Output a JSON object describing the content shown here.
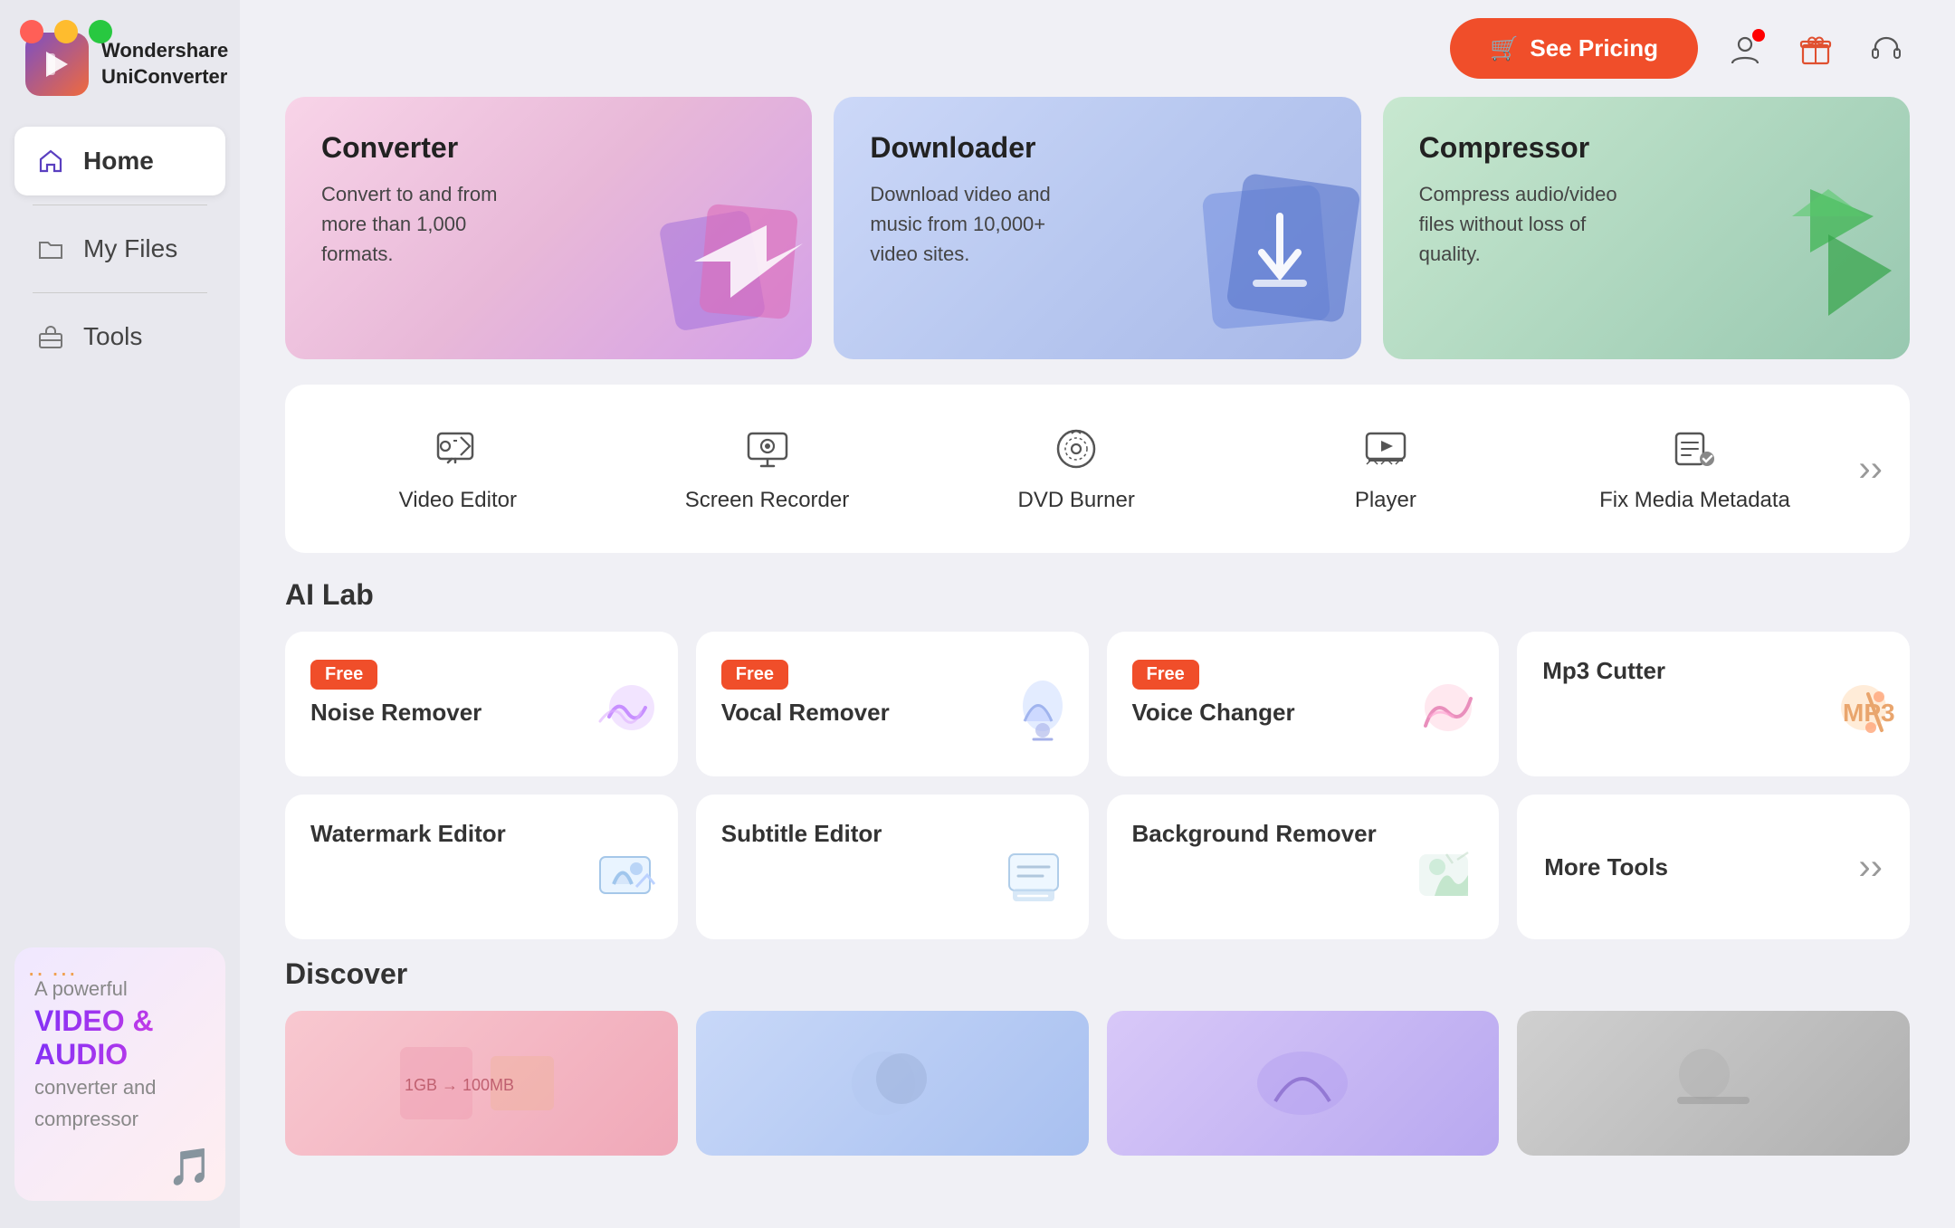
{
  "app": {
    "name_line1": "Wondershare",
    "name_line2": "UniConverter"
  },
  "topbar": {
    "see_pricing_label": "See Pricing",
    "cart_icon": "🛒"
  },
  "sidebar": {
    "nav_items": [
      {
        "id": "home",
        "label": "Home",
        "active": true,
        "icon": "home"
      },
      {
        "id": "myfiles",
        "label": "My Files",
        "active": false,
        "icon": "folder"
      },
      {
        "id": "tools",
        "label": "Tools",
        "active": false,
        "icon": "toolbox"
      }
    ]
  },
  "banner": {
    "line1": "A powerful",
    "highlight_line1": "VIDEO &",
    "highlight_line2": "AUDIO",
    "line2": "converter and",
    "line3": "compressor"
  },
  "feature_cards": [
    {
      "id": "converter",
      "title": "Converter",
      "desc": "Convert to and from more than 1,000 formats.",
      "theme": "converter"
    },
    {
      "id": "downloader",
      "title": "Downloader",
      "desc": "Download video and music from 10,000+ video sites.",
      "theme": "downloader"
    },
    {
      "id": "compressor",
      "title": "Compressor",
      "desc": "Compress audio/video files without loss of quality.",
      "theme": "compressor"
    }
  ],
  "tools": [
    {
      "id": "video-editor",
      "label": "Video Editor",
      "icon": "✂️"
    },
    {
      "id": "screen-recorder",
      "label": "Screen Recorder",
      "icon": "🖥️"
    },
    {
      "id": "dvd-burner",
      "label": "DVD Burner",
      "icon": "💿"
    },
    {
      "id": "player",
      "label": "Player",
      "icon": "📺"
    },
    {
      "id": "fix-media",
      "label": "Fix Media Metadata",
      "icon": "🔧"
    }
  ],
  "ai_lab": {
    "section_title": "AI Lab",
    "row1": [
      {
        "id": "noise-remover",
        "label": "Noise Remover",
        "free": true
      },
      {
        "id": "vocal-remover",
        "label": "Vocal Remover",
        "free": true
      },
      {
        "id": "voice-changer",
        "label": "Voice Changer",
        "free": true
      },
      {
        "id": "mp3-cutter",
        "label": "Mp3 Cutter",
        "free": false
      }
    ],
    "row2": [
      {
        "id": "watermark-editor",
        "label": "Watermark Editor",
        "free": false
      },
      {
        "id": "subtitle-editor",
        "label": "Subtitle Editor",
        "free": false
      },
      {
        "id": "background-remover",
        "label": "Background Remover",
        "free": false
      },
      {
        "id": "more-tools",
        "label": "More Tools",
        "free": false,
        "arrow": true
      }
    ]
  },
  "discover": {
    "section_title": "Discover",
    "cards": [
      {
        "id": "d1",
        "theme": "pink"
      },
      {
        "id": "d2",
        "theme": "blue"
      },
      {
        "id": "d3",
        "theme": "purple"
      },
      {
        "id": "d4",
        "theme": "gray"
      }
    ]
  },
  "free_label": "Free",
  "more_tools_label": "More Tools"
}
